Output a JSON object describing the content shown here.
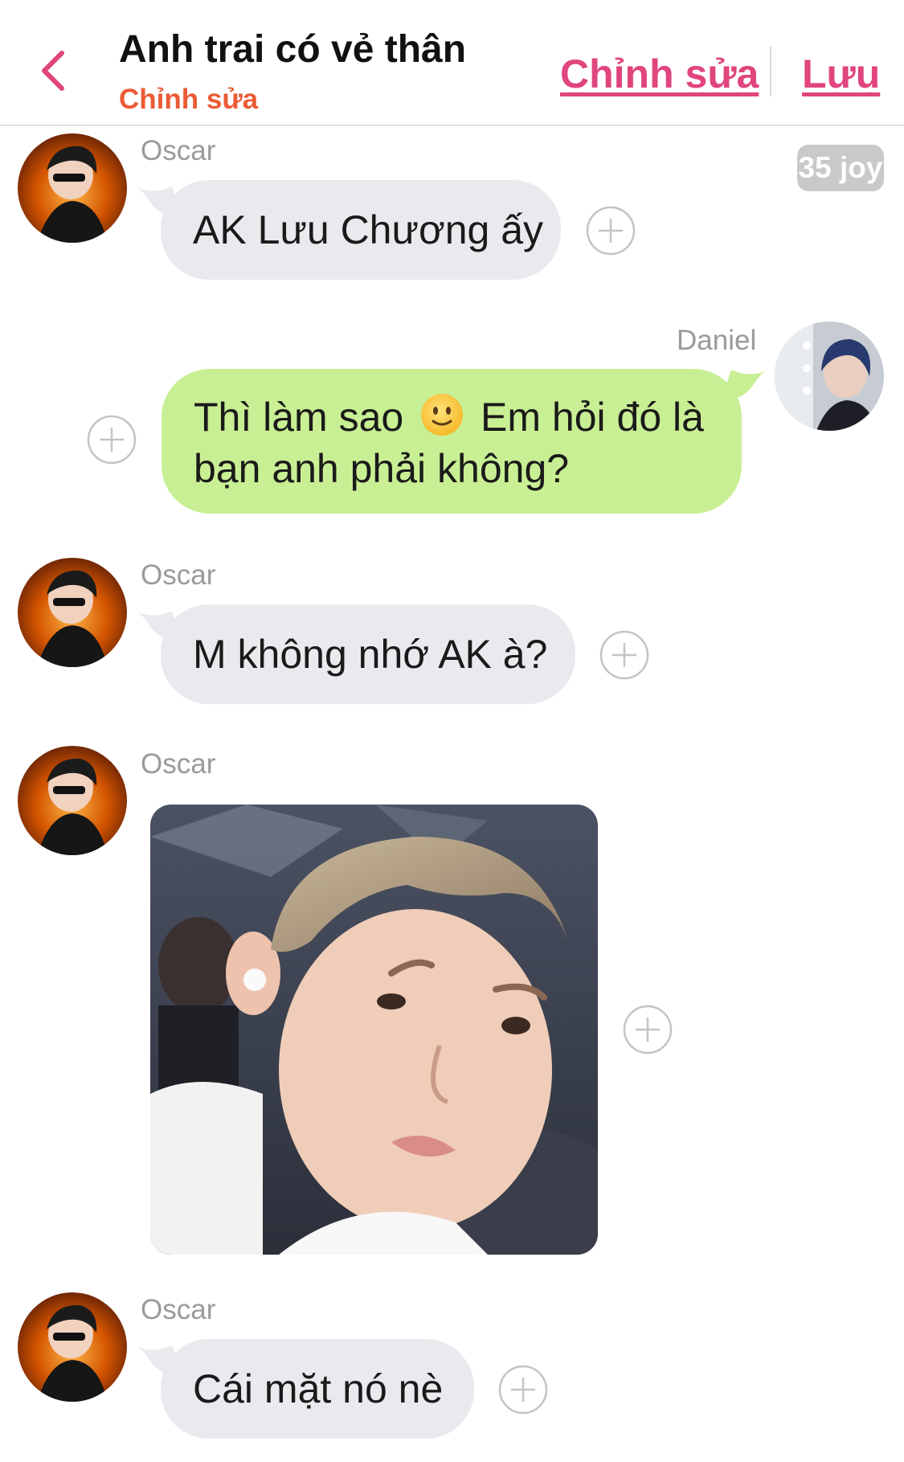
{
  "header": {
    "title": "Anh trai có vẻ thân",
    "subtitle": "Chỉnh sửa",
    "edit_label": "Chỉnh sửa",
    "save_label": "Lưu",
    "back_icon": "chevron-left-icon",
    "accent_color": "#e0457e"
  },
  "badge": {
    "text": "35 joy"
  },
  "messages": [
    {
      "sender": "Oscar",
      "text": "AK Lưu Chương ấy"
    },
    {
      "sender": "Daniel",
      "text_part1": "Thì làm sao",
      "emoji": "slightly-smiling-face-icon",
      "text_part2": "Em hỏi đó là",
      "text_line2": "bạn anh phải không?"
    },
    {
      "sender": "Oscar",
      "text": "M không nhớ AK à?"
    },
    {
      "sender": "Oscar",
      "type": "image",
      "image_description_icon": "photo-icon"
    },
    {
      "sender": "Oscar",
      "text": "Cái mặt nó nè"
    }
  ],
  "colors": {
    "incoming_bubble": "#e9eaee",
    "outgoing_bubble": "#c9ef94",
    "subtitle": "#ea5b35"
  }
}
